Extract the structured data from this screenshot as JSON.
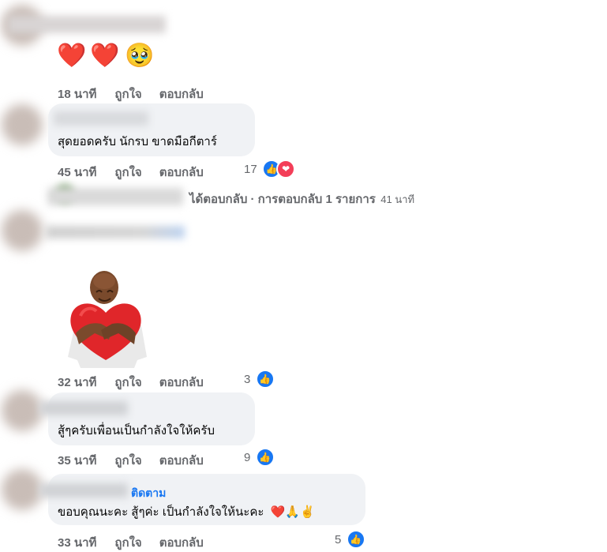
{
  "comments": [
    {
      "emojis": [
        "❤️",
        "❤️",
        "🥹"
      ],
      "time": "18 นาที",
      "like": "ถูกใจ",
      "reply": "ตอบกลับ"
    },
    {
      "text": "สุดยอดครับ นักรบ ขาดมือกีตาร์",
      "time": "45 นาที",
      "like": "ถูกใจ",
      "reply": "ตอบกลับ",
      "reaction_count": "17"
    },
    {
      "reply_summary": "ได้ตอบกลับ · การตอบกลับ 1 รายการ",
      "reply_summary_time": "41 นาที"
    },
    {
      "sticker": "hugging-heart-sticker",
      "time": "32 นาที",
      "like": "ถูกใจ",
      "reply": "ตอบกลับ",
      "reaction_count": "3"
    },
    {
      "text": "สู้ๆครับเพื่อนเป็นกำลังใจให้ครับ",
      "time": "35 นาที",
      "like": "ถูกใจ",
      "reply": "ตอบกลับ",
      "reaction_count": "9"
    },
    {
      "follow": "ติดตาม",
      "text": "ขอบคุณนะคะ สู้ๆค่ะ เป็นกำลังใจให้นะคะ",
      "trailing_emojis": "❤️🙏✌️",
      "time": "33 นาที",
      "like": "ถูกใจ",
      "reply": "ตอบกลับ",
      "reaction_count": "5"
    }
  ],
  "colors": {
    "bubble": "#f0f2f5",
    "meta": "#65676b",
    "link": "#1877f2",
    "like": "#1877f2",
    "love": "#f33e58"
  },
  "icons": [
    "like-icon",
    "love-icon"
  ]
}
